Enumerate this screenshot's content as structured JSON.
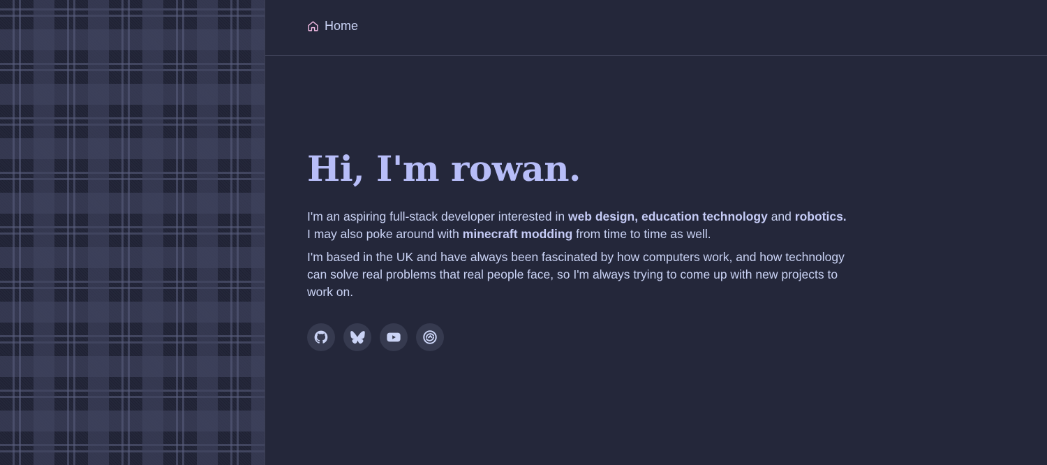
{
  "nav": {
    "home_label": "Home",
    "home_icon": "home-icon",
    "home_icon_color": "#f5bde6"
  },
  "hero": {
    "title": "Hi, I'm rowan."
  },
  "intro": {
    "p1_a": "I'm an aspiring full-stack developer interested in ",
    "p1_b": "web design, education technology",
    "p1_c": " and ",
    "p1_d": "robotics.",
    "p2_a": "I may also poke around with ",
    "p2_b": "minecraft modding",
    "p2_c": " from time to time as well.",
    "p3": "I'm based in the UK and have always been fascinated by how computers work, and how technology can solve real problems that real people face, so I'm always trying to come up with new projects to work on."
  },
  "socials": [
    {
      "icon": "github-icon"
    },
    {
      "icon": "bluesky-icon"
    },
    {
      "icon": "youtube-icon"
    },
    {
      "icon": "modrinth-icon"
    }
  ],
  "colors": {
    "background": "#24273a",
    "heading": "#b7bdf8",
    "text": "#cad3f5",
    "social_bg": "#363a4f",
    "accent_pink": "#f5bde6"
  }
}
